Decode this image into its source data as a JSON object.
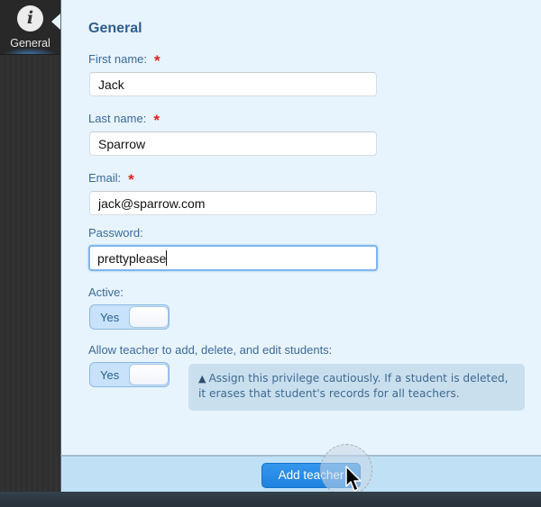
{
  "sidebar": {
    "items": [
      {
        "label": "General",
        "icon": "info-icon",
        "active": true
      }
    ]
  },
  "form": {
    "section_title": "General",
    "fields": {
      "first_name": {
        "label": "First name:",
        "value": "Jack",
        "required": true
      },
      "last_name": {
        "label": "Last name:",
        "value": "Sparrow",
        "required": true
      },
      "email": {
        "label": "Email:",
        "value": "jack@sparrow.com",
        "required": true
      },
      "password": {
        "label": "Password:",
        "value": "prettyplease",
        "required": false,
        "focused": true
      }
    },
    "required_marker": "*",
    "active": {
      "label": "Active:",
      "toggle_label": "Yes"
    },
    "allow_edit_students": {
      "label": "Allow teacher to add, delete, and edit students:",
      "toggle_label": "Yes",
      "warning": "Assign this privilege cautiously. If a student is deleted, it erases that student's records for all teachers."
    }
  },
  "footer": {
    "submit_label": "Add teacher"
  },
  "icons": {
    "info": "i",
    "warning": "▲"
  }
}
